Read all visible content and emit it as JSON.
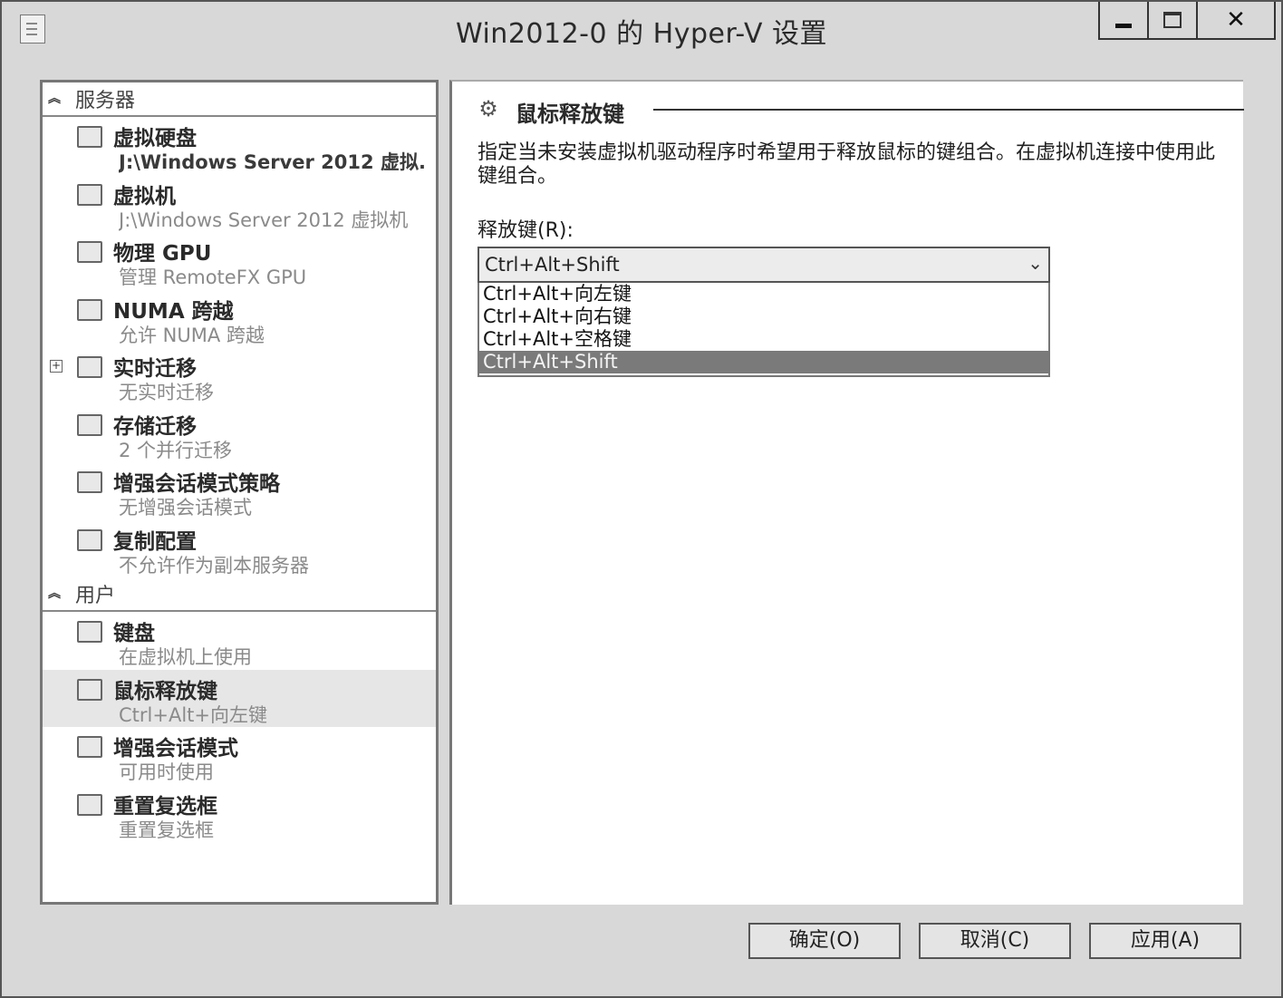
{
  "window": {
    "title": "Win2012-0 的 Hyper-V 设置",
    "minimize_glyph": "—",
    "maximize_glyph": "□",
    "close_glyph": "✕"
  },
  "left": {
    "server_section": "服务器",
    "user_section": "用户",
    "server_items": [
      {
        "title": "虚拟硬盘",
        "sub": "J:\\Windows Server 2012 虚拟...",
        "icon": "hard-disk-icon"
      },
      {
        "title": "虚拟机",
        "sub": "J:\\Windows Server 2012 虚拟机",
        "icon": "virtual-machine-icon"
      },
      {
        "title": "物理 GPU",
        "sub": "管理 RemoteFX GPU",
        "icon": "gpu-icon"
      },
      {
        "title": "NUMA 跨越",
        "sub": "允许 NUMA 跨越",
        "icon": "numa-icon"
      },
      {
        "title": "实时迁移",
        "sub": "无实时迁移",
        "icon": "live-migration-icon"
      },
      {
        "title": "存储迁移",
        "sub": "2 个并行迁移",
        "icon": "storage-migration-icon"
      },
      {
        "title": "增强会话模式策略",
        "sub": "无增强会话模式",
        "icon": "enhanced-session-policy-icon"
      },
      {
        "title": "复制配置",
        "sub": "不允许作为副本服务器",
        "icon": "replication-icon"
      }
    ],
    "user_items": [
      {
        "title": "键盘",
        "sub": "在虚拟机上使用",
        "icon": "keyboard-icon"
      },
      {
        "title": "鼠标释放键",
        "sub": "Ctrl+Alt+向左键",
        "icon": "mouse-release-icon"
      },
      {
        "title": "增强会话模式",
        "sub": "可用时使用",
        "icon": "enhanced-session-icon"
      },
      {
        "title": "重置复选框",
        "sub": "重置复选框",
        "icon": "reset-checkbox-icon"
      }
    ]
  },
  "right": {
    "title": "鼠标释放键",
    "description": "指定当未安装虚拟机驱动程序时希望用于释放鼠标的键组合。在虚拟机连接中使用此键组合。",
    "label": "释放键(R):",
    "selected": "Ctrl+Alt+Shift",
    "options": [
      "Ctrl+Alt+向左键",
      "Ctrl+Alt+向右键",
      "Ctrl+Alt+空格键",
      "Ctrl+Alt+Shift"
    ],
    "highlighted_option": "Ctrl+Alt+Shift"
  },
  "buttons": {
    "ok": "确定(O)",
    "cancel": "取消(C)",
    "apply": "应用(A)"
  }
}
